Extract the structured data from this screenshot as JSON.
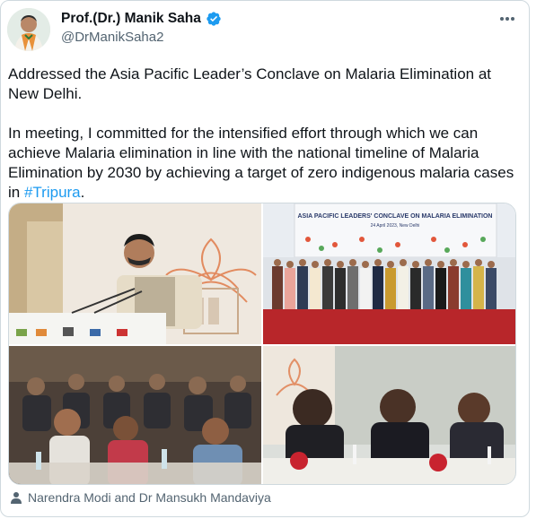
{
  "author": {
    "name": "Prof.(Dr.) Manik Saha",
    "handle": "@DrManikSaha2",
    "verified": true,
    "verified_color": "#1d9bf0"
  },
  "menu_icon": "more-horizontal-icon",
  "tweet": {
    "paragraph1": "Addressed the Asia Pacific Leader’s Conclave on Malaria Elimination at New Delhi.",
    "paragraph2_text": "In meeting, I committed for the intensified effort through which we can achieve Malaria elimination in line with the national timeline of Malaria Elimination by 2030 by achieving a target of zero indigenous malaria cases in ",
    "hashtag": "#Tripura",
    "paragraph2_end": "."
  },
  "photos": {
    "p2_banner_title": "ASIA PACIFIC LEADERS' CONCLAVE ON MALARIA ELIMINATION",
    "p2_banner_date": "24 April 2023, New Delhi"
  },
  "tagged": {
    "icon": "person-icon",
    "text": "Narendra Modi and Dr Mansukh Mandaviya"
  },
  "colors": {
    "text": "#0f1419",
    "secondary": "#536471",
    "link": "#1d9bf0",
    "border": "#cfd9de"
  }
}
